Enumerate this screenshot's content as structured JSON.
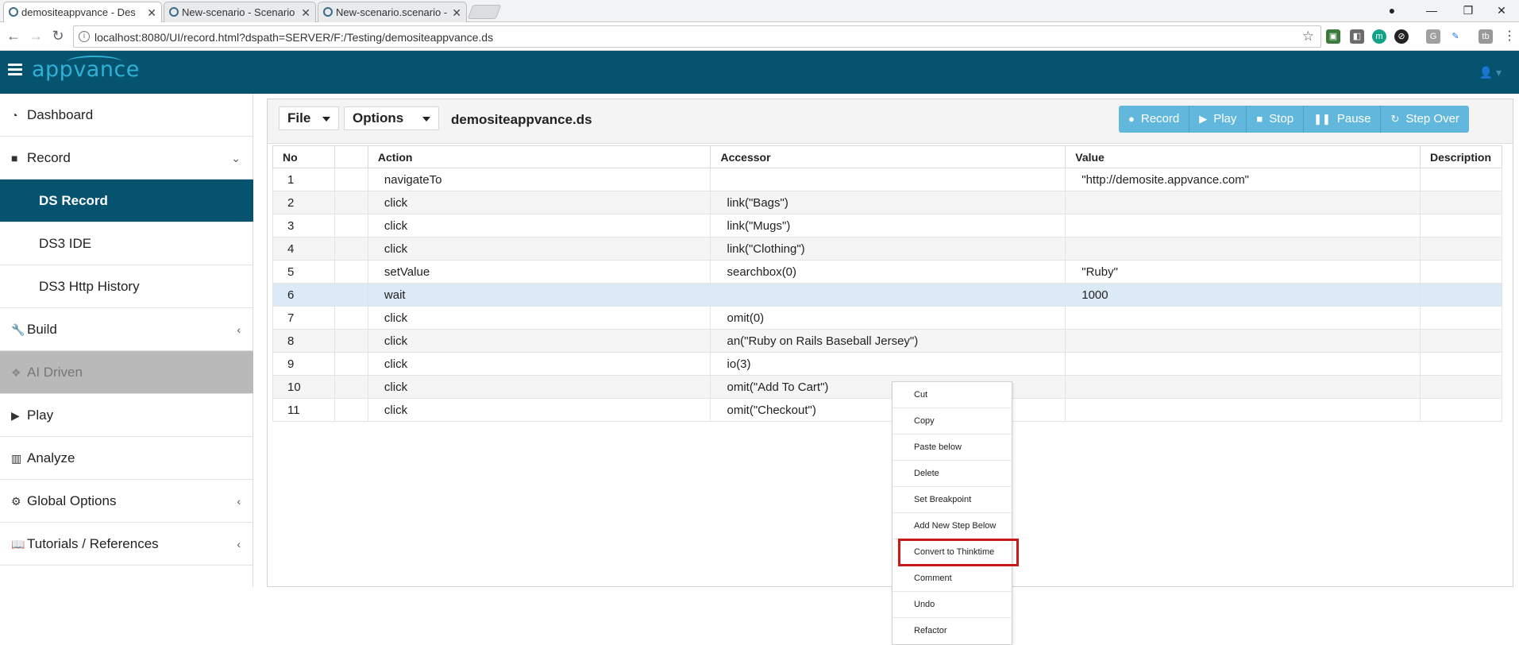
{
  "browser": {
    "tabs": [
      {
        "title": "demositeappvance - Des",
        "active": true
      },
      {
        "title": "New-scenario - Scenario",
        "active": false
      },
      {
        "title": "New-scenario.scenario -",
        "active": false
      }
    ],
    "url": "localhost:8080/UI/record.html?dspath=SERVER/F:/Testing/demositeappvance.ds"
  },
  "app": {
    "logo": "appvance"
  },
  "sidebar": {
    "items": [
      {
        "label": "Dashboard",
        "icon": "dashboard-icon"
      },
      {
        "label": "Record",
        "icon": "video-camera-icon"
      },
      {
        "label": "DS Record"
      },
      {
        "label": "DS3 IDE"
      },
      {
        "label": "DS3 Http History"
      },
      {
        "label": "Build",
        "icon": "wrench-icon"
      },
      {
        "label": "AI Driven",
        "icon": "cubes-icon"
      },
      {
        "label": "Play",
        "icon": "play-icon"
      },
      {
        "label": "Analyze",
        "icon": "bar-chart-icon"
      },
      {
        "label": "Global Options",
        "icon": "cogs-icon"
      },
      {
        "label": "Tutorials / References",
        "icon": "book-icon"
      }
    ]
  },
  "toolbar": {
    "file_label": "File",
    "options_label": "Options",
    "filename": "demositeappvance.ds",
    "record_label": "Record",
    "play_label": "Play",
    "stop_label": "Stop",
    "pause_label": "Pause",
    "stepover_label": "Step Over",
    "button_color": "#62b8dc"
  },
  "table": {
    "columns": [
      "No",
      "",
      "Action",
      "Accessor",
      "Value",
      "Description"
    ],
    "rows": [
      {
        "no": "1",
        "action": "navigateTo",
        "accessor": "",
        "value": "\"http://demosite.appvance.com\""
      },
      {
        "no": "2",
        "action": "click",
        "accessor": "link(\"Bags\")",
        "value": ""
      },
      {
        "no": "3",
        "action": "click",
        "accessor": "link(\"Mugs\")",
        "value": ""
      },
      {
        "no": "4",
        "action": "click",
        "accessor": "link(\"Clothing\")",
        "value": ""
      },
      {
        "no": "5",
        "action": "setValue",
        "accessor": "searchbox(0)",
        "value": "\"Ruby\""
      },
      {
        "no": "6",
        "action": "wait",
        "accessor": "",
        "value": "1000"
      },
      {
        "no": "7",
        "action": "click",
        "accessor": "omit(0)",
        "value": ""
      },
      {
        "no": "8",
        "action": "click",
        "accessor": "an(\"Ruby on Rails Baseball Jersey\")",
        "value": ""
      },
      {
        "no": "9",
        "action": "click",
        "accessor": "io(3)",
        "value": ""
      },
      {
        "no": "10",
        "action": "click",
        "accessor": "omit(\"Add To Cart\")",
        "value": ""
      },
      {
        "no": "11",
        "action": "click",
        "accessor": "omit(\"Checkout\")",
        "value": ""
      }
    ]
  },
  "context_menu": {
    "items": [
      "Cut",
      "Copy",
      "Paste below",
      "Delete",
      "Set Breakpoint",
      "Add New Step Below",
      "Convert to Thinktime",
      "Comment",
      "Undo",
      "Refactor"
    ],
    "highlighted": "Convert to Thinktime",
    "highlight_color": "#c8181a"
  }
}
